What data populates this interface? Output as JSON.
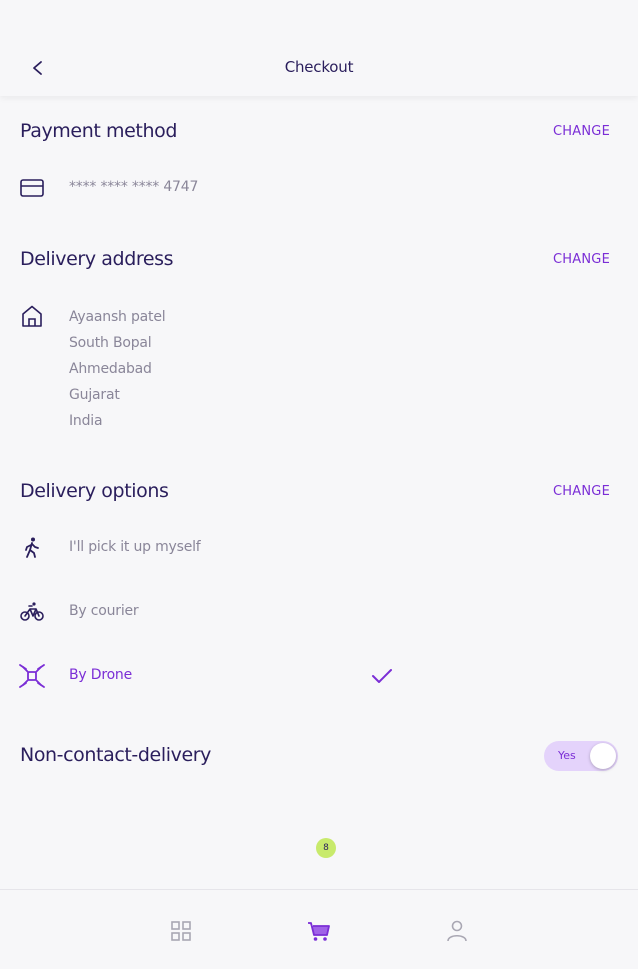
{
  "header": {
    "title": "Checkout",
    "back_icon": "chevron-left-icon"
  },
  "payment": {
    "title": "Payment method",
    "change_label": "CHANGE",
    "card_icon": "credit-card-icon",
    "card_number": "**** **** **** 4747"
  },
  "delivery_address": {
    "title": "Delivery address",
    "change_label": "CHANGE",
    "icon": "home-icon",
    "lines": [
      "Ayaansh patel",
      "South Bopal",
      "Ahmedabad",
      "Gujarat",
      "India"
    ]
  },
  "delivery_options": {
    "title": "Delivery options",
    "change_label": "CHANGE",
    "options": [
      {
        "label": "I'll pick it up myself",
        "icon": "walking-person-icon",
        "selected": false
      },
      {
        "label": "By courier",
        "icon": "bicycle-icon",
        "selected": false
      },
      {
        "label": "By Drone",
        "icon": "drone-icon",
        "selected": true
      }
    ]
  },
  "non_contact": {
    "title": "Non-contact-delivery",
    "toggle_label": "Yes",
    "enabled": true
  },
  "cart_badge": "8",
  "bottom_nav": [
    {
      "icon": "grid-icon",
      "active": false
    },
    {
      "icon": "cart-icon",
      "active": true
    },
    {
      "icon": "profile-icon",
      "active": false
    }
  ],
  "colors": {
    "accent": "#7b2ed6",
    "text": "#2a1e5c",
    "muted": "#8a8699",
    "badge": "#c8ea6c",
    "toggle_bg": "#e4d3fb"
  }
}
